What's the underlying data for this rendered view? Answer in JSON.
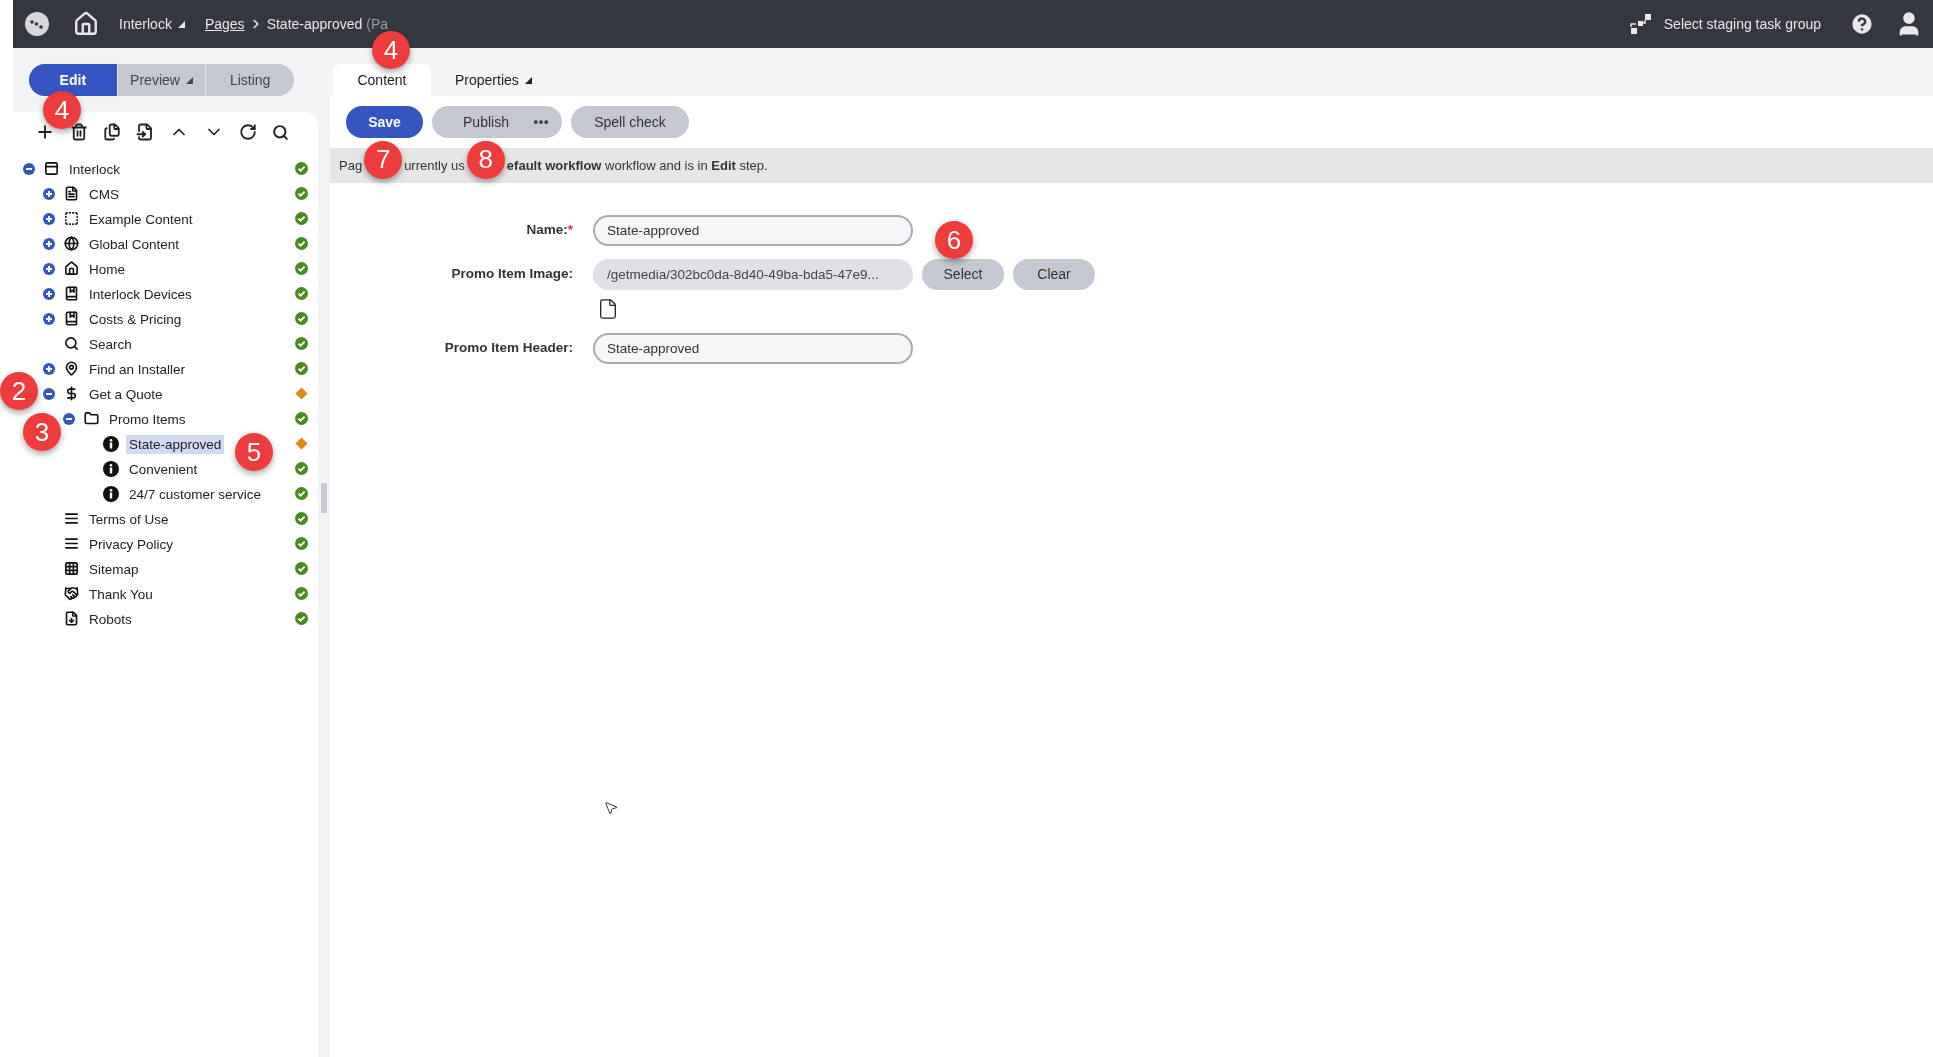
{
  "top_bar": {
    "site": "Interlock",
    "breadcrumb": [
      {
        "label": "Pages",
        "kind": "link"
      },
      {
        "label": "State-approved",
        "kind": "current"
      },
      {
        "label": "(Pa",
        "kind": "type"
      }
    ],
    "staging": "Select staging task group"
  },
  "modes": [
    {
      "label": "Edit",
      "selected": true,
      "dropdown": false
    },
    {
      "label": "Preview",
      "selected": false,
      "dropdown": true
    },
    {
      "label": "Listing",
      "selected": false,
      "dropdown": false
    }
  ],
  "tree": [
    {
      "label": "Interlock",
      "kind": "site",
      "changed": false,
      "selected": false,
      "expanded": true,
      "children": [
        {
          "label": "CMS",
          "kind": "cms",
          "changed": false,
          "selected": false,
          "expanded": false
        },
        {
          "label": "Example Content",
          "kind": "content",
          "changed": false,
          "selected": false,
          "expanded": false
        },
        {
          "label": "Global Content",
          "kind": "global",
          "changed": false,
          "selected": false,
          "expanded": false
        },
        {
          "label": "Home",
          "kind": "home",
          "changed": false,
          "selected": false,
          "expanded": false
        },
        {
          "label": "Interlock Devices",
          "kind": "section",
          "changed": false,
          "selected": false,
          "expanded": false
        },
        {
          "label": "Costs & Pricing",
          "kind": "section",
          "changed": false,
          "selected": false,
          "expanded": false
        },
        {
          "label": "Search",
          "kind": "search",
          "changed": false,
          "selected": false
        },
        {
          "label": "Find an Installer",
          "kind": "location",
          "changed": false,
          "selected": false,
          "expanded": false
        },
        {
          "label": "Get a Quote",
          "kind": "quote",
          "changed": true,
          "selected": false,
          "expanded": true,
          "children": [
            {
              "label": "Promo Items",
              "kind": "folder",
              "changed": false,
              "selected": false,
              "expanded": true,
              "children": [
                {
                  "label": "State-approved",
                  "kind": "promo",
                  "changed": true,
                  "selected": true
                },
                {
                  "label": "Convenient",
                  "kind": "promo",
                  "changed": false,
                  "selected": false
                },
                {
                  "label": "24/7 customer service",
                  "kind": "promo",
                  "changed": false,
                  "selected": false
                }
              ]
            }
          ]
        },
        {
          "label": "Terms of Use",
          "kind": "text",
          "changed": false,
          "selected": false
        },
        {
          "label": "Privacy Policy",
          "kind": "text",
          "changed": false,
          "selected": false
        },
        {
          "label": "Sitemap",
          "kind": "sitemap",
          "changed": false,
          "selected": false
        },
        {
          "label": "Thank You",
          "kind": "thanks",
          "changed": false,
          "selected": false
        },
        {
          "label": "Robots",
          "kind": "robots",
          "changed": false,
          "selected": false
        }
      ]
    }
  ],
  "tabs": [
    {
      "label": "Content",
      "selected": true,
      "dropdown": false
    },
    {
      "label": "Properties",
      "selected": false,
      "dropdown": true
    }
  ],
  "actions": [
    {
      "label": "Save",
      "kind": "primary"
    },
    {
      "label": "Publish",
      "kind": "split"
    },
    {
      "label": "Spell check",
      "kind": "secondary"
    }
  ],
  "notice": [
    "Pag",
    "urrently us",
    "**efault workflow** workflow and is in **Edit** step."
  ],
  "form": [
    {
      "label": "Name:",
      "required": "*",
      "kind": "text",
      "value": "State-approved"
    },
    {
      "label": "Promo Item Image:",
      "kind": "media",
      "value": "/getmedia/302bc0da-8d40-49ba-bda5-47e9...",
      "buttons": [
        "Select",
        "Clear"
      ]
    },
    {
      "label": "Promo Item Header:",
      "kind": "text",
      "value": "State-approved"
    }
  ],
  "callouts": [
    "4",
    "4",
    "2",
    "3",
    "5",
    "6",
    "7",
    "8"
  ]
}
